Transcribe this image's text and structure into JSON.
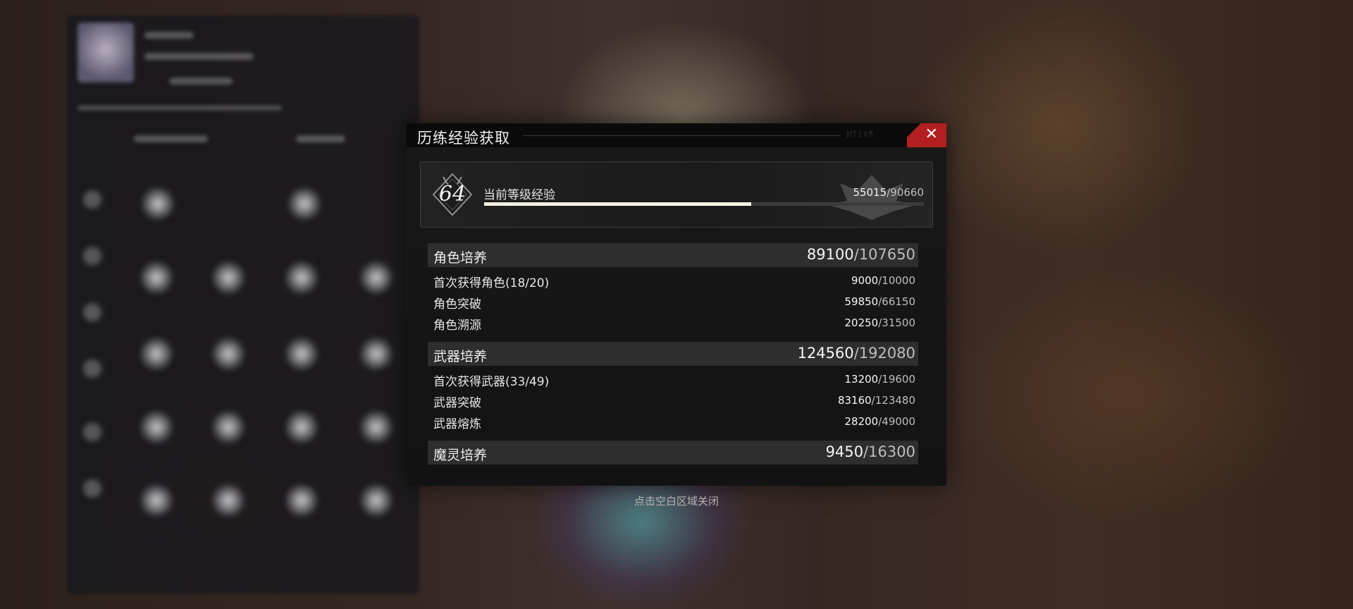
{
  "modal": {
    "title": "历练经验获取",
    "header_deco": "ᛞᛉᛇᛟᛗ",
    "close_icon": "✕"
  },
  "level": {
    "number": "64",
    "label": "当前等级经验",
    "current": "55015",
    "max": "/90660",
    "progress": 0.607
  },
  "sections": [
    {
      "label": "角色培养",
      "current": "89100",
      "max": "/107650",
      "items": [
        {
          "label": "首次获得角色(18/20)",
          "current": "9000",
          "max": "/10000"
        },
        {
          "label": "角色突破",
          "current": "59850",
          "max": "/66150"
        },
        {
          "label": "角色溯源",
          "current": "20250",
          "max": "/31500"
        }
      ]
    },
    {
      "label": "武器培养",
      "current": "124560",
      "max": "/192080",
      "items": [
        {
          "label": "首次获得武器(33/49)",
          "current": "13200",
          "max": "/19600"
        },
        {
          "label": "武器突破",
          "current": "83160",
          "max": "/123480"
        },
        {
          "label": "武器熔炼",
          "current": "28200",
          "max": "/49000"
        }
      ]
    },
    {
      "label": "魔灵培养",
      "current": "9450",
      "max": "/16300",
      "items": []
    }
  ],
  "hint": "点击空白区域关闭",
  "colors": {
    "accent_red": "#b31f1f",
    "progress_fill": "#fff8e6",
    "panel_bg": "#121212"
  }
}
